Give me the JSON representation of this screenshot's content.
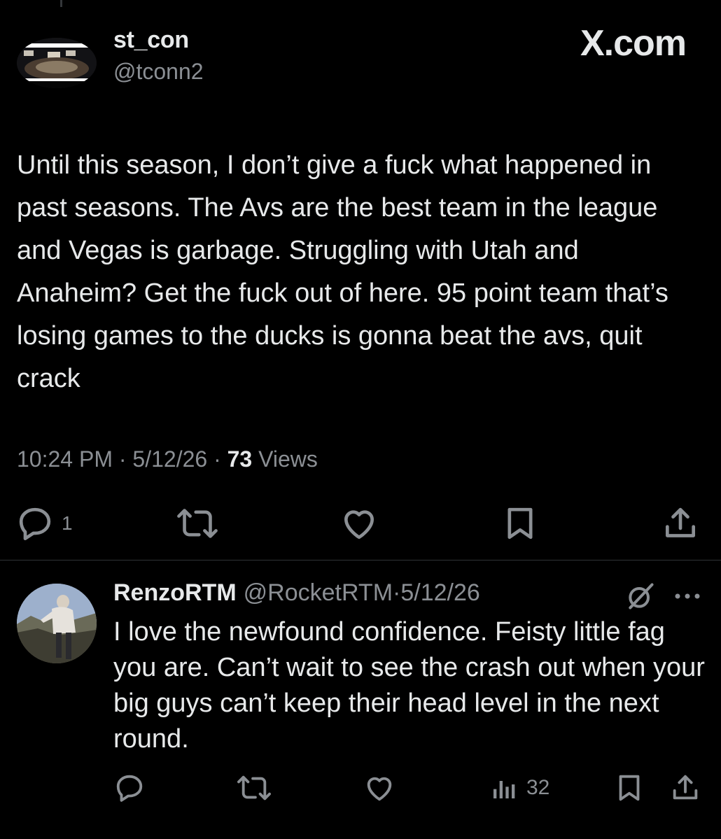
{
  "tweet": {
    "author_name": "st_con",
    "author_handle": "@tconn2",
    "brand": "X.com",
    "text": "Until this season, I don’t give a fuck what happened in past seasons. The Avs are the best team in the league and Vegas is garbage. Struggling with Utah and Anaheim? Get the fuck out of here. 95 point team that’s losing games to the ducks is gonna beat the avs, quit crack",
    "time": "10:24 PM",
    "date": "5/12/26",
    "views_count": "73",
    "views_label": "Views",
    "separator": "·",
    "reply_count": "1",
    "icons": [
      "reply-icon",
      "retweet-icon",
      "like-icon",
      "bookmark-icon",
      "share-icon"
    ]
  },
  "reply": {
    "author_name": "RenzoRTM",
    "author_handle": "@RocketRTM",
    "date_text": "·5/12/26",
    "text": "I love the newfound confidence. Feisty little fag you are. Can’t wait to see the crash out when your big guys can’t keep their head level in the next round.",
    "views_count": "32",
    "icons": [
      "grok-icon",
      "more-icon",
      "reply-icon",
      "retweet-icon",
      "like-icon",
      "views-icon",
      "bookmark-icon",
      "share-icon"
    ]
  },
  "colors": {
    "background": "#000000",
    "text": "#e7e9ea",
    "muted": "#8b8f94",
    "divider": "#2f3336"
  }
}
